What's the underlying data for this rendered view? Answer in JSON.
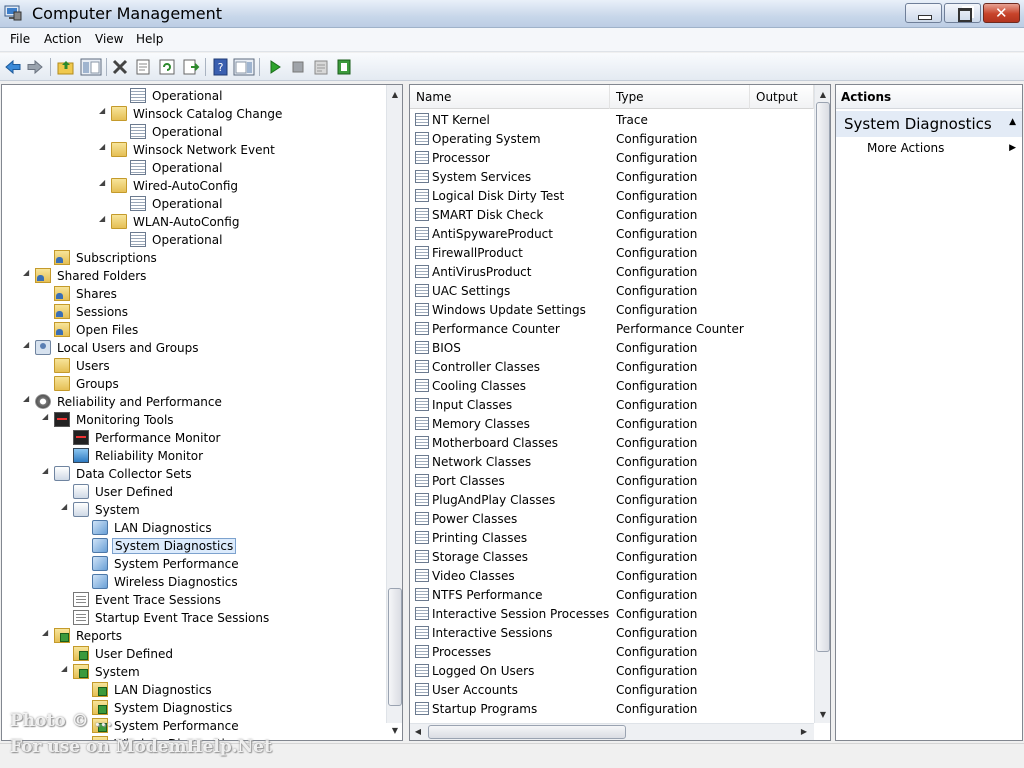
{
  "window": {
    "title": "Computer Management"
  },
  "menu": [
    "File",
    "Action",
    "View",
    "Help"
  ],
  "toolbar_icons": [
    "back-arrow-icon",
    "forward-arrow-icon",
    "up-folder-icon",
    "show-hide-tree-icon",
    "delete-icon",
    "properties-icon",
    "refresh-icon",
    "export-list-icon",
    "help-icon",
    "show-hide-action-pane-icon",
    "start-icon",
    "stop-icon",
    "schedule-icon",
    "latest-report-icon"
  ],
  "tree": [
    {
      "label": "Operational",
      "icon": "doc",
      "depth": 6,
      "arrow": ""
    },
    {
      "label": "Winsock Catalog Change",
      "icon": "folder",
      "depth": 5,
      "arrow": "open"
    },
    {
      "label": "Operational",
      "icon": "doc",
      "depth": 6,
      "arrow": ""
    },
    {
      "label": "Winsock Network Event",
      "icon": "folder",
      "depth": 5,
      "arrow": "open"
    },
    {
      "label": "Operational",
      "icon": "doc",
      "depth": 6,
      "arrow": ""
    },
    {
      "label": "Wired-AutoConfig",
      "icon": "folder",
      "depth": 5,
      "arrow": "open"
    },
    {
      "label": "Operational",
      "icon": "doc",
      "depth": 6,
      "arrow": ""
    },
    {
      "label": "WLAN-AutoConfig",
      "icon": "folder",
      "depth": 5,
      "arrow": "open"
    },
    {
      "label": "Operational",
      "icon": "doc",
      "depth": 6,
      "arrow": ""
    },
    {
      "label": "Subscriptions",
      "icon": "share",
      "depth": 2,
      "arrow": ""
    },
    {
      "label": "Shared Folders",
      "icon": "share",
      "depth": 1,
      "arrow": "open"
    },
    {
      "label": "Shares",
      "icon": "share",
      "depth": 2,
      "arrow": ""
    },
    {
      "label": "Sessions",
      "icon": "share",
      "depth": 2,
      "arrow": ""
    },
    {
      "label": "Open Files",
      "icon": "share",
      "depth": 2,
      "arrow": ""
    },
    {
      "label": "Local Users and Groups",
      "icon": "users",
      "depth": 1,
      "arrow": "open"
    },
    {
      "label": "Users",
      "icon": "folder",
      "depth": 2,
      "arrow": ""
    },
    {
      "label": "Groups",
      "icon": "folder",
      "depth": 2,
      "arrow": ""
    },
    {
      "label": "Reliability and Performance",
      "icon": "gear",
      "depth": 1,
      "arrow": "open"
    },
    {
      "label": "Monitoring Tools",
      "icon": "monitor",
      "depth": 2,
      "arrow": "open"
    },
    {
      "label": "Performance Monitor",
      "icon": "monitor",
      "depth": 3,
      "arrow": ""
    },
    {
      "label": "Reliability Monitor",
      "icon": "reliab",
      "depth": 3,
      "arrow": ""
    },
    {
      "label": "Data Collector Sets",
      "icon": "dcs",
      "depth": 2,
      "arrow": "open"
    },
    {
      "label": "User Defined",
      "icon": "dcs",
      "depth": 3,
      "arrow": ""
    },
    {
      "label": "System",
      "icon": "dcs",
      "depth": 3,
      "arrow": "open"
    },
    {
      "label": "LAN Diagnostics",
      "icon": "diag",
      "depth": 4,
      "arrow": ""
    },
    {
      "label": "System Diagnostics",
      "icon": "diag",
      "depth": 4,
      "arrow": "",
      "selected": true
    },
    {
      "label": "System Performance",
      "icon": "diag",
      "depth": 4,
      "arrow": ""
    },
    {
      "label": "Wireless Diagnostics",
      "icon": "diag",
      "depth": 4,
      "arrow": ""
    },
    {
      "label": "Event Trace Sessions",
      "icon": "trace",
      "depth": 3,
      "arrow": ""
    },
    {
      "label": "Startup Event Trace Sessions",
      "icon": "trace",
      "depth": 3,
      "arrow": ""
    },
    {
      "label": "Reports",
      "icon": "report",
      "depth": 2,
      "arrow": "open"
    },
    {
      "label": "User Defined",
      "icon": "report",
      "depth": 3,
      "arrow": ""
    },
    {
      "label": "System",
      "icon": "report",
      "depth": 3,
      "arrow": "open"
    },
    {
      "label": "LAN Diagnostics",
      "icon": "report",
      "depth": 4,
      "arrow": ""
    },
    {
      "label": "System Diagnostics",
      "icon": "report",
      "depth": 4,
      "arrow": ""
    },
    {
      "label": "System Performance",
      "icon": "report",
      "depth": 4,
      "arrow": ""
    },
    {
      "label": "Wireless Diagnostics",
      "icon": "report",
      "depth": 4,
      "arrow": ""
    }
  ],
  "list": {
    "columns": [
      "Name",
      "Type",
      "Output"
    ],
    "rows": [
      {
        "name": "NT Kernel",
        "type": "Trace"
      },
      {
        "name": "Operating System",
        "type": "Configuration"
      },
      {
        "name": "Processor",
        "type": "Configuration"
      },
      {
        "name": "System Services",
        "type": "Configuration"
      },
      {
        "name": "Logical Disk Dirty Test",
        "type": "Configuration"
      },
      {
        "name": "SMART Disk Check",
        "type": "Configuration"
      },
      {
        "name": "AntiSpywareProduct",
        "type": "Configuration"
      },
      {
        "name": "FirewallProduct",
        "type": "Configuration"
      },
      {
        "name": "AntiVirusProduct",
        "type": "Configuration"
      },
      {
        "name": "UAC Settings",
        "type": "Configuration"
      },
      {
        "name": "Windows Update Settings",
        "type": "Configuration"
      },
      {
        "name": "Performance Counter",
        "type": "Performance Counter"
      },
      {
        "name": "BIOS",
        "type": "Configuration"
      },
      {
        "name": "Controller Classes",
        "type": "Configuration"
      },
      {
        "name": "Cooling Classes",
        "type": "Configuration"
      },
      {
        "name": "Input Classes",
        "type": "Configuration"
      },
      {
        "name": "Memory Classes",
        "type": "Configuration"
      },
      {
        "name": "Motherboard Classes",
        "type": "Configuration"
      },
      {
        "name": "Network Classes",
        "type": "Configuration"
      },
      {
        "name": "Port Classes",
        "type": "Configuration"
      },
      {
        "name": "PlugAndPlay Classes",
        "type": "Configuration"
      },
      {
        "name": "Power Classes",
        "type": "Configuration"
      },
      {
        "name": "Printing Classes",
        "type": "Configuration"
      },
      {
        "name": "Storage Classes",
        "type": "Configuration"
      },
      {
        "name": "Video Classes",
        "type": "Configuration"
      },
      {
        "name": "NTFS Performance",
        "type": "Configuration"
      },
      {
        "name": "Interactive Session Processes",
        "type": "Configuration"
      },
      {
        "name": "Interactive Sessions",
        "type": "Configuration"
      },
      {
        "name": "Processes",
        "type": "Configuration"
      },
      {
        "name": "Logged On Users",
        "type": "Configuration"
      },
      {
        "name": "User Accounts",
        "type": "Configuration"
      },
      {
        "name": "Startup Programs",
        "type": "Configuration"
      }
    ]
  },
  "actions": {
    "header": "Actions",
    "section": "System Diagnostics",
    "items": [
      "More Actions"
    ]
  },
  "watermark": {
    "line1": "Photo © ...",
    "line2": "For use on ModemHelp.Net"
  }
}
